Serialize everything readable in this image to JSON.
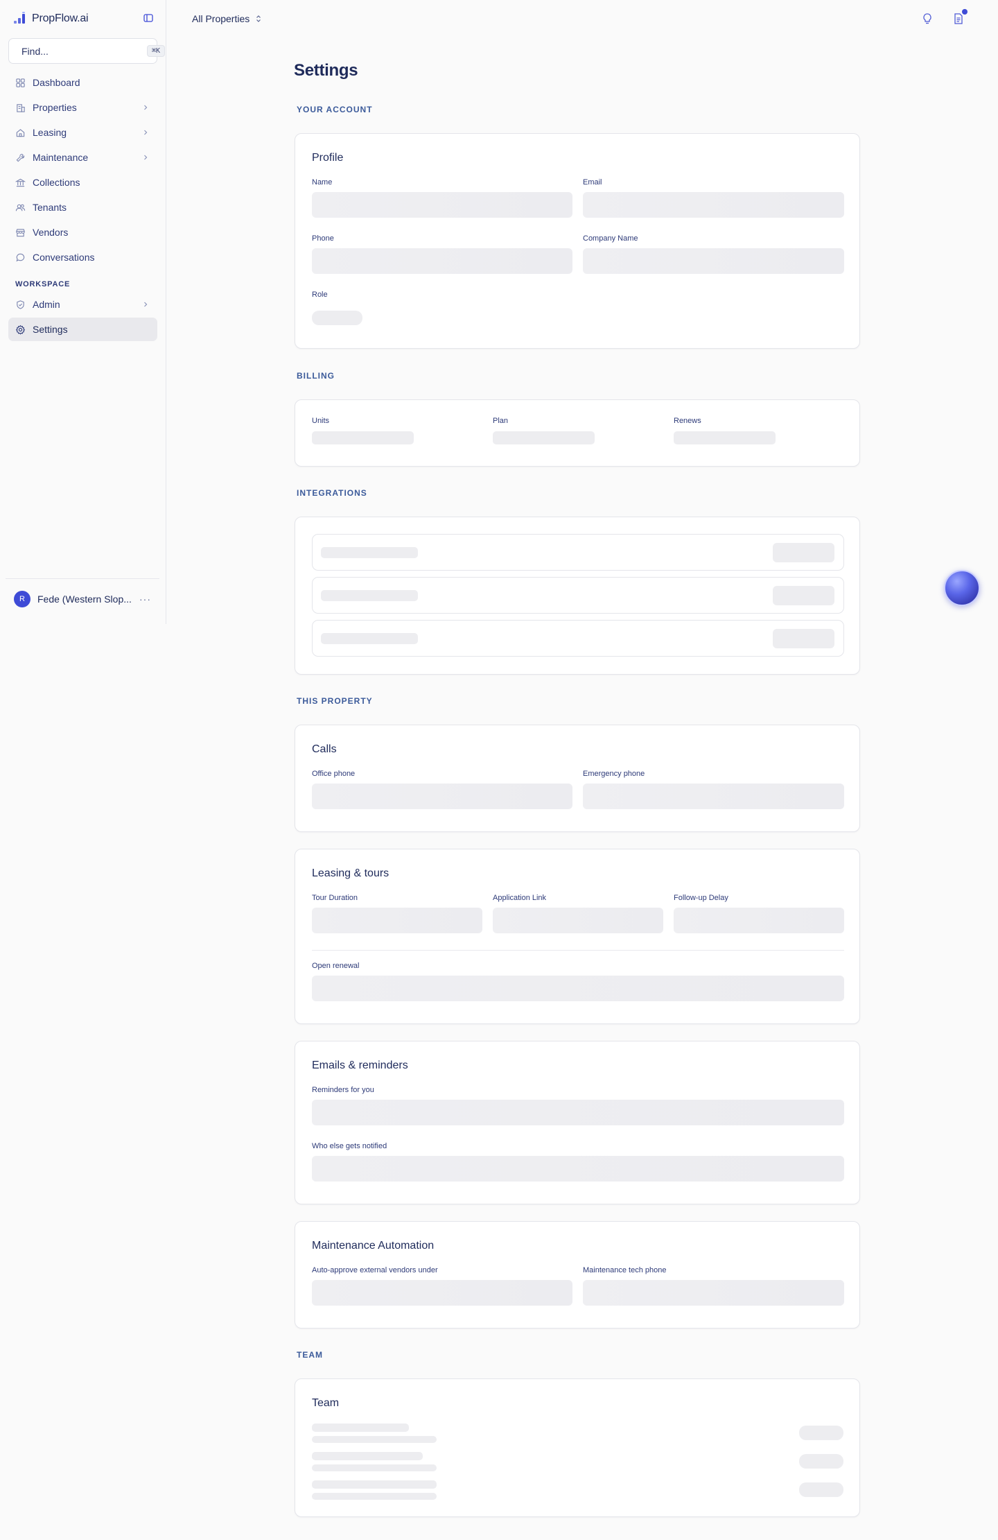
{
  "app": {
    "brand": "PropFlow.ai"
  },
  "sidebar": {
    "search": {
      "placeholder": "Find...",
      "shortcut": "⌘K"
    },
    "items": [
      {
        "label": "Dashboard",
        "icon": "grid-icon"
      },
      {
        "label": "Properties",
        "icon": "building-icon",
        "has_chevron": true
      },
      {
        "label": "Leasing",
        "icon": "home-icon",
        "has_chevron": true
      },
      {
        "label": "Maintenance",
        "icon": "wrench-icon",
        "has_chevron": true
      },
      {
        "label": "Collections",
        "icon": "bank-icon"
      },
      {
        "label": "Tenants",
        "icon": "users-icon"
      },
      {
        "label": "Vendors",
        "icon": "store-icon"
      },
      {
        "label": "Conversations",
        "icon": "chat-icon"
      }
    ],
    "workspace_label": "WORKSPACE",
    "workspace_items": [
      {
        "label": "Admin",
        "icon": "shield-icon",
        "has_chevron": true
      },
      {
        "label": "Settings",
        "icon": "gear-icon",
        "active": true
      }
    ],
    "user": {
      "initial": "R",
      "name": "Fede (Western Slop..."
    }
  },
  "topbar": {
    "property_selector": "All Properties"
  },
  "page": {
    "title": "Settings"
  },
  "sections": {
    "your_account": "YOUR ACCOUNT",
    "billing": "BILLING",
    "integrations": "INTEGRATIONS",
    "this_property": "THIS PROPERTY",
    "team": "TEAM"
  },
  "profile": {
    "title": "Profile",
    "name_label": "Name",
    "email_label": "Email",
    "phone_label": "Phone",
    "company_label": "Company Name",
    "role_label": "Role"
  },
  "billing": {
    "units_label": "Units",
    "plan_label": "Plan",
    "renews_label": "Renews"
  },
  "calls": {
    "title": "Calls",
    "office_phone_label": "Office phone",
    "emergency_phone_label": "Emergency phone"
  },
  "leasing": {
    "title": "Leasing & tours",
    "tour_duration_label": "Tour Duration",
    "application_link_label": "Application Link",
    "followup_delay_label": "Follow-up Delay",
    "open_renewal_label": "Open renewal"
  },
  "emails": {
    "title": "Emails & reminders",
    "reminders_label": "Reminders for you",
    "notified_label": "Who else gets notified"
  },
  "maintenance": {
    "title": "Maintenance Automation",
    "auto_approve_label": "Auto-approve external vendors under",
    "tech_phone_label": "Maintenance tech phone"
  },
  "team": {
    "title": "Team"
  },
  "colors": {
    "accent": "#3e4bd6",
    "nav_text": "#2d3a78",
    "section_head": "#3b5a9a",
    "skeleton": "#efeff2"
  }
}
